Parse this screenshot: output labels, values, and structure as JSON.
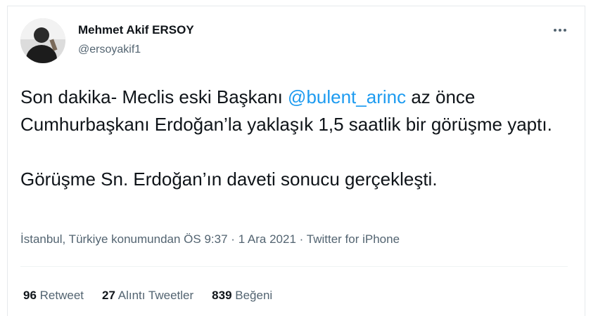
{
  "author": {
    "display_name": "Mehmet Akif ERSOY",
    "handle": "@ersoyakif1"
  },
  "tweet": {
    "line1_pre": "Son dakika- Meclis eski Başkanı ",
    "mention": "@bulent_arinc",
    "line1_post": " az önce Cumhurbaşkanı Erdoğan’la yaklaşık 1,5 saatlik bir görüşme yaptı.",
    "paragraph2": "Görüşme Sn. Erdoğan’ın daveti sonucu gerçekleşti."
  },
  "meta": {
    "location": "İstanbul, Türkiye konumundan",
    "time": "ÖS 9:37",
    "date": "1 Ara 2021",
    "source": "Twitter for iPhone",
    "separator": "·"
  },
  "stats": {
    "retweet_count": "96",
    "retweet_label": "Retweet",
    "quote_count": "27",
    "quote_label": "Alıntı Tweetler",
    "like_count": "839",
    "like_label": "Beğeni"
  },
  "icons": {
    "more": "more-horizontal-icon"
  }
}
